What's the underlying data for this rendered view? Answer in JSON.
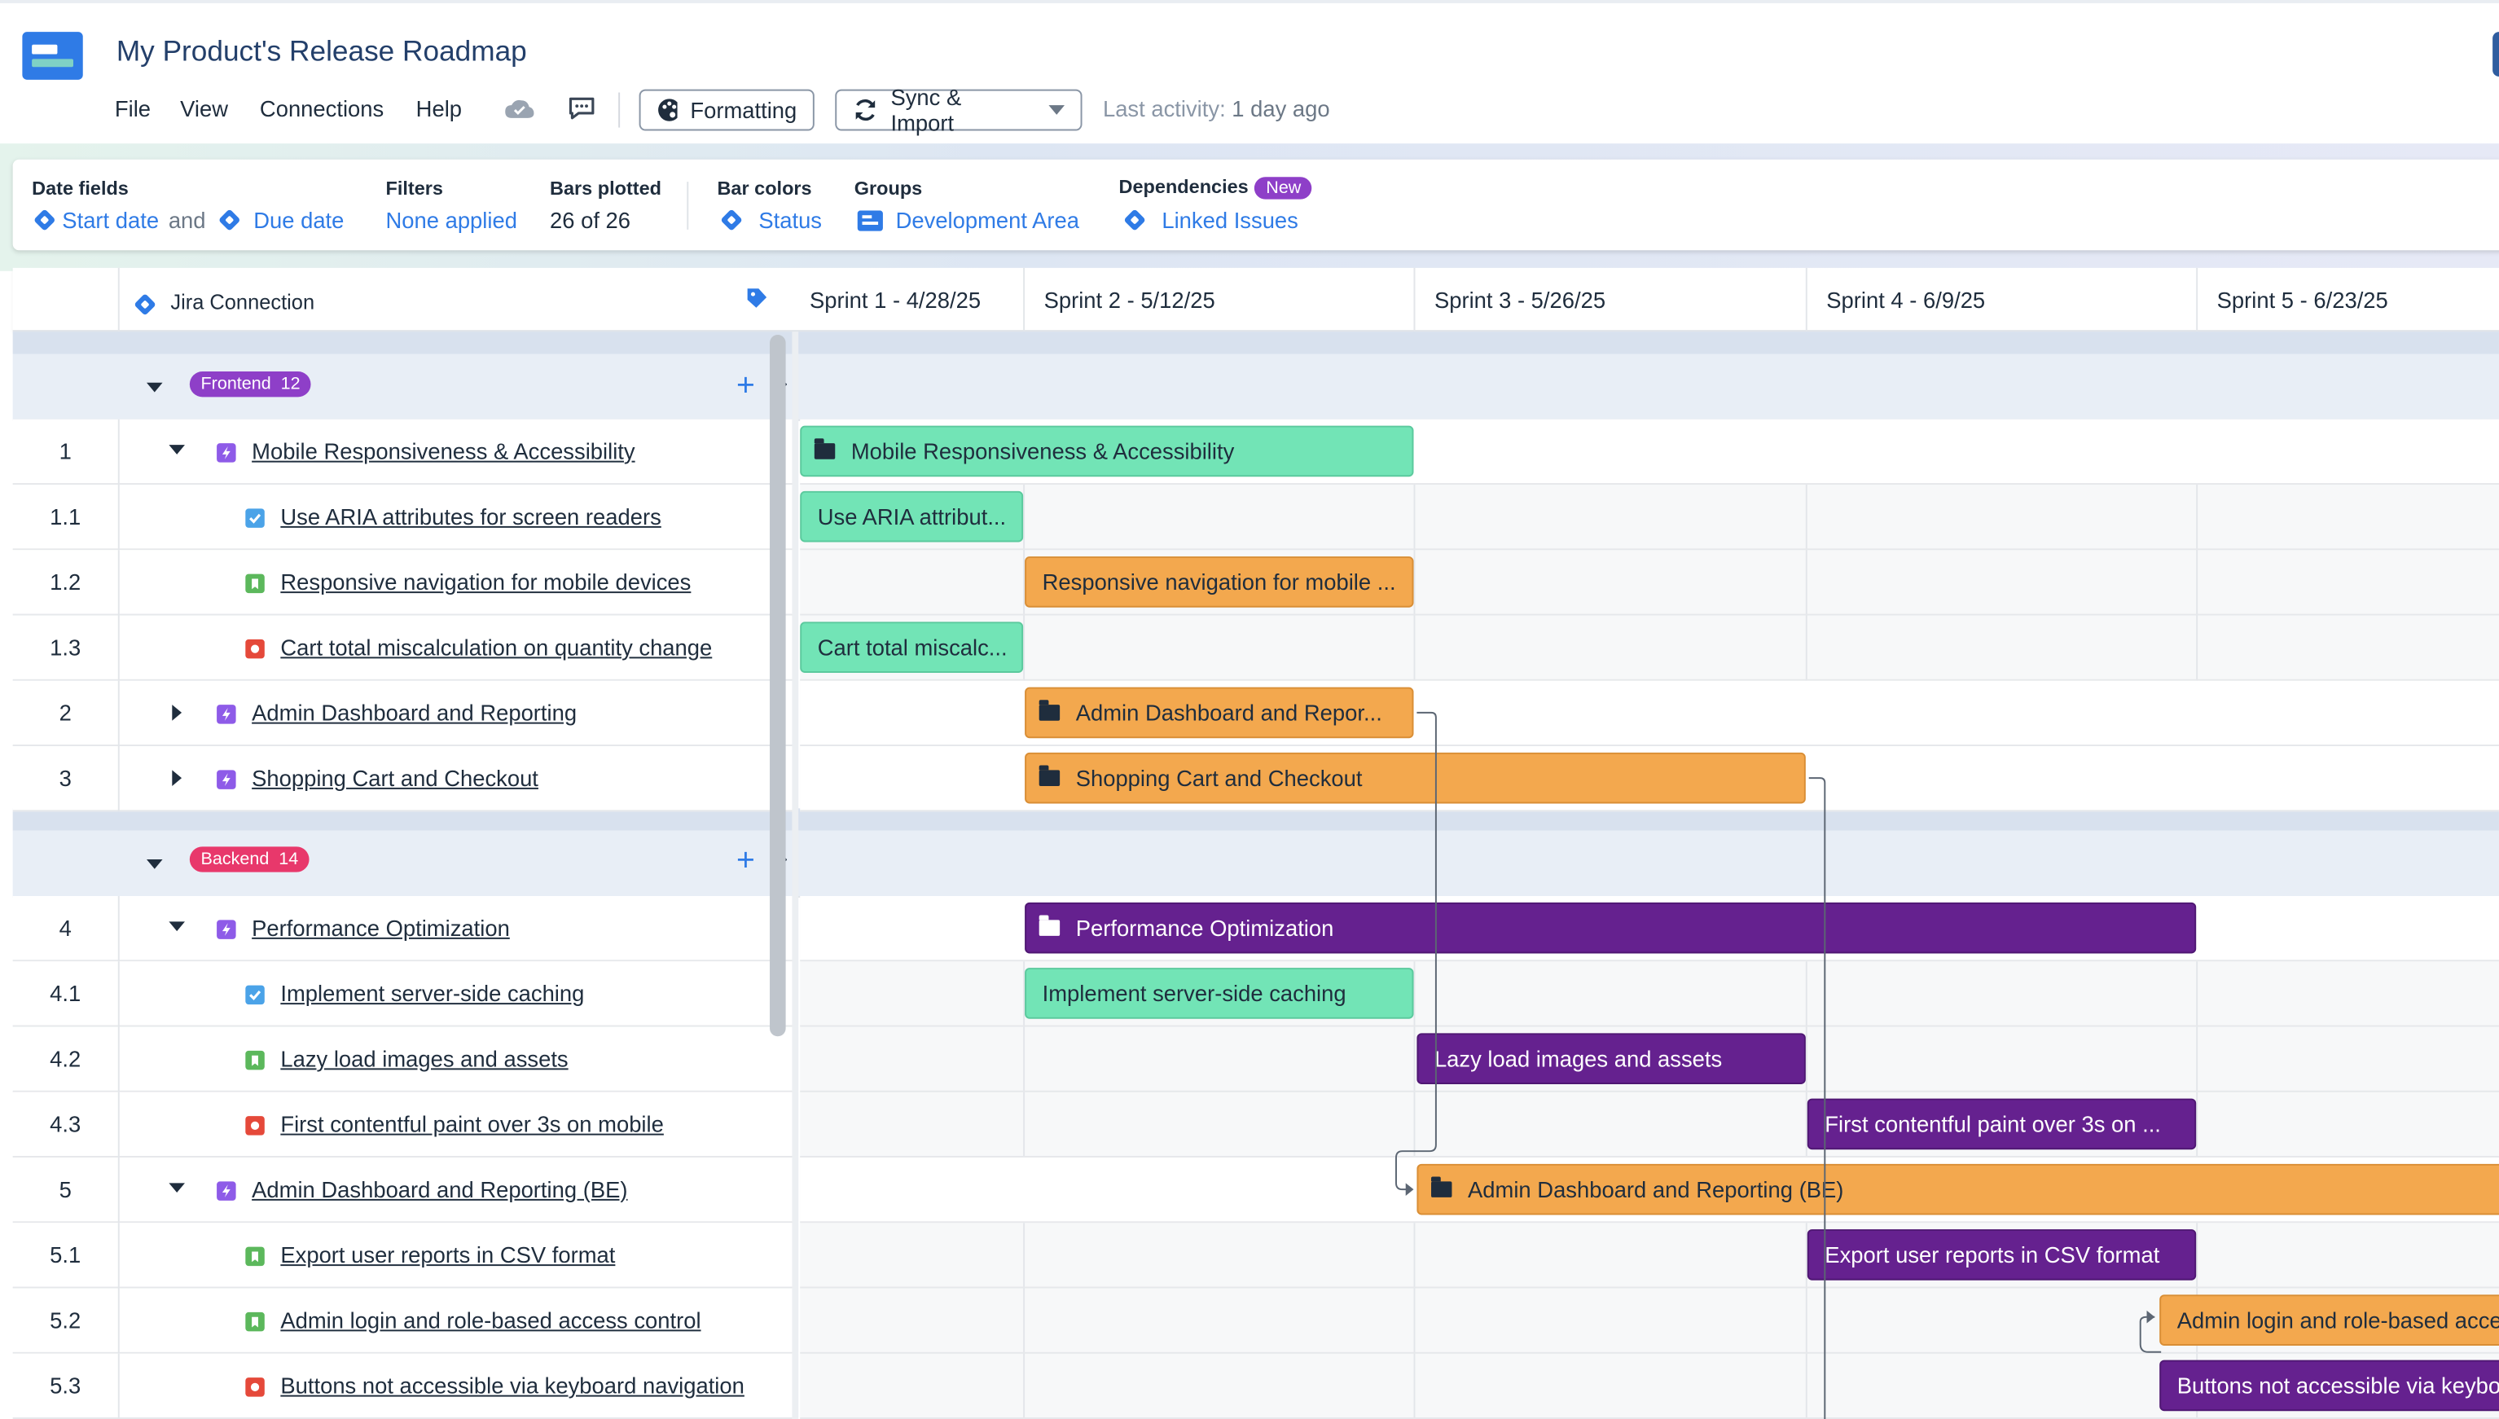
{
  "app": {
    "title": "My Product's Release Roadmap",
    "menu": [
      "File",
      "View",
      "Connections",
      "Help"
    ],
    "formatting_label": "Formatting",
    "sync_label": "Sync & Import",
    "last_activity_label": "Last activity:",
    "last_activity_value": "1 day ago"
  },
  "settings": {
    "date_fields": {
      "label": "Date fields",
      "start": "Start date",
      "and": "and",
      "due": "Due date"
    },
    "filters": {
      "label": "Filters",
      "value": "None applied"
    },
    "bars_plotted": {
      "label": "Bars plotted",
      "value": "26 of 26"
    },
    "bar_colors": {
      "label": "Bar colors",
      "value": "Status"
    },
    "groups": {
      "label": "Groups",
      "value": "Development Area"
    },
    "dependencies": {
      "label": "Dependencies",
      "badge": "New",
      "value": "Linked Issues"
    }
  },
  "grid": {
    "connection_label": "Jira Connection",
    "sprints": [
      "Sprint 1 - 4/28/25",
      "Sprint 2 - 5/12/25",
      "Sprint 3 - 5/26/25",
      "Sprint 4 - 6/9/25",
      "Sprint 5 - 6/23/25"
    ]
  },
  "groups": [
    {
      "name": "Frontend",
      "count": "12",
      "color": "#8e3fc8"
    },
    {
      "name": "Backend",
      "count": "14",
      "color": "#e8386b"
    }
  ],
  "rows": [
    {
      "num": "1",
      "title": "Mobile Responsiveness & Accessibility",
      "type": "epic",
      "bar": "Mobile Responsiveness & Accessibility"
    },
    {
      "num": "1.1",
      "title": "Use ARIA attributes for screen readers",
      "type": "task",
      "bar": "Use ARIA attribut..."
    },
    {
      "num": "1.2",
      "title": "Responsive navigation for mobile devices",
      "type": "story",
      "bar": "Responsive navigation for mobile ..."
    },
    {
      "num": "1.3",
      "title": "Cart total miscalculation on quantity change",
      "type": "bug",
      "bar": "Cart total miscalc..."
    },
    {
      "num": "2",
      "title": "Admin Dashboard and Reporting",
      "type": "epic",
      "bar": "Admin Dashboard and Repor..."
    },
    {
      "num": "3",
      "title": "Shopping Cart and Checkout",
      "type": "epic",
      "bar": "Shopping Cart and Checkout"
    },
    {
      "num": "4",
      "title": "Performance Optimization",
      "type": "epic",
      "bar": "Performance Optimization"
    },
    {
      "num": "4.1",
      "title": "Implement server-side caching",
      "type": "task",
      "bar": "Implement server-side caching"
    },
    {
      "num": "4.2",
      "title": "Lazy load images and assets",
      "type": "story",
      "bar": "Lazy load images and assets"
    },
    {
      "num": "4.3",
      "title": "First contentful paint over 3s on mobile",
      "type": "bug",
      "bar": "First contentful paint over 3s on ..."
    },
    {
      "num": "5",
      "title": "Admin Dashboard and Reporting (BE)",
      "type": "epic",
      "bar": "Admin Dashboard and Reporting (BE)"
    },
    {
      "num": "5.1",
      "title": "Export user reports in CSV format",
      "type": "story",
      "bar": "Export user reports in CSV format"
    },
    {
      "num": "5.2",
      "title": "Admin login and role-based access control",
      "type": "story",
      "bar": "Admin login and role-based acce"
    },
    {
      "num": "5.3",
      "title": "Buttons not accessible via keyboard navigation",
      "type": "bug",
      "bar": "Buttons not accessible via keybo"
    }
  ],
  "colors": {
    "green": "#72e4b6",
    "orange": "#f3a84e",
    "purple": "#65218f",
    "accent": "#2f7be6"
  }
}
